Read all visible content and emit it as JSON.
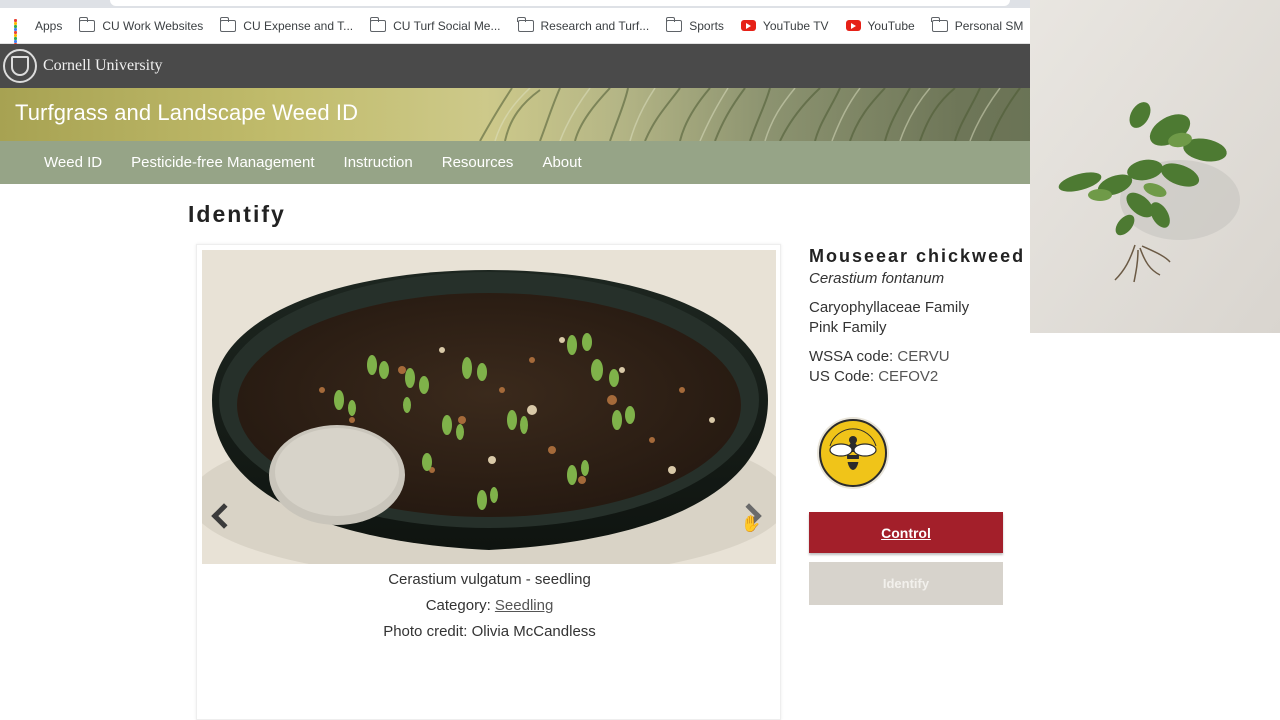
{
  "bookmarks": [
    {
      "label": "Apps",
      "icon": "apps-grid-icon"
    },
    {
      "label": "CU Work Websites",
      "icon": "folder-icon"
    },
    {
      "label": "CU Expense and T...",
      "icon": "folder-icon"
    },
    {
      "label": "CU Turf Social Me...",
      "icon": "folder-icon"
    },
    {
      "label": "Research and Turf...",
      "icon": "folder-icon"
    },
    {
      "label": "Sports",
      "icon": "folder-icon"
    },
    {
      "label": "YouTube TV",
      "icon": "youtube-icon"
    },
    {
      "label": "YouTube",
      "icon": "youtube-icon"
    },
    {
      "label": "Personal SM",
      "icon": "folder-icon"
    }
  ],
  "university": {
    "name": "Cornell University"
  },
  "site": {
    "title": "Turfgrass and Landscape Weed ID"
  },
  "nav": [
    "Weed ID",
    "Pesticide-free Management",
    "Instruction",
    "Resources",
    "About"
  ],
  "page": {
    "heading": "Identify"
  },
  "carousel": {
    "caption": "Cerastium vulgatum - seedling",
    "category_label": "Category: ",
    "category_value": "Seedling",
    "credit": "Photo credit: Olivia McCandless"
  },
  "species": {
    "common_name": "Mouseear chickweed",
    "scientific_name": "Cerastium fontanum",
    "family": "Caryophyllaceae Family",
    "family_common": "Pink Family",
    "wssa_label": "WSSA code: ",
    "wssa_code": "CERVU",
    "us_label": "US Code: ",
    "us_code": "CEFOV2",
    "badge": "pollinator-icon"
  },
  "buttons": {
    "control": "Control",
    "identify": "Identify"
  },
  "colors": {
    "cornell_bar": "#4a4a4a",
    "nav_bg": "#96a487",
    "control_red": "#a31f2a",
    "identify_disabled": "#d7d3cc",
    "badge_yellow": "#f0c419"
  }
}
